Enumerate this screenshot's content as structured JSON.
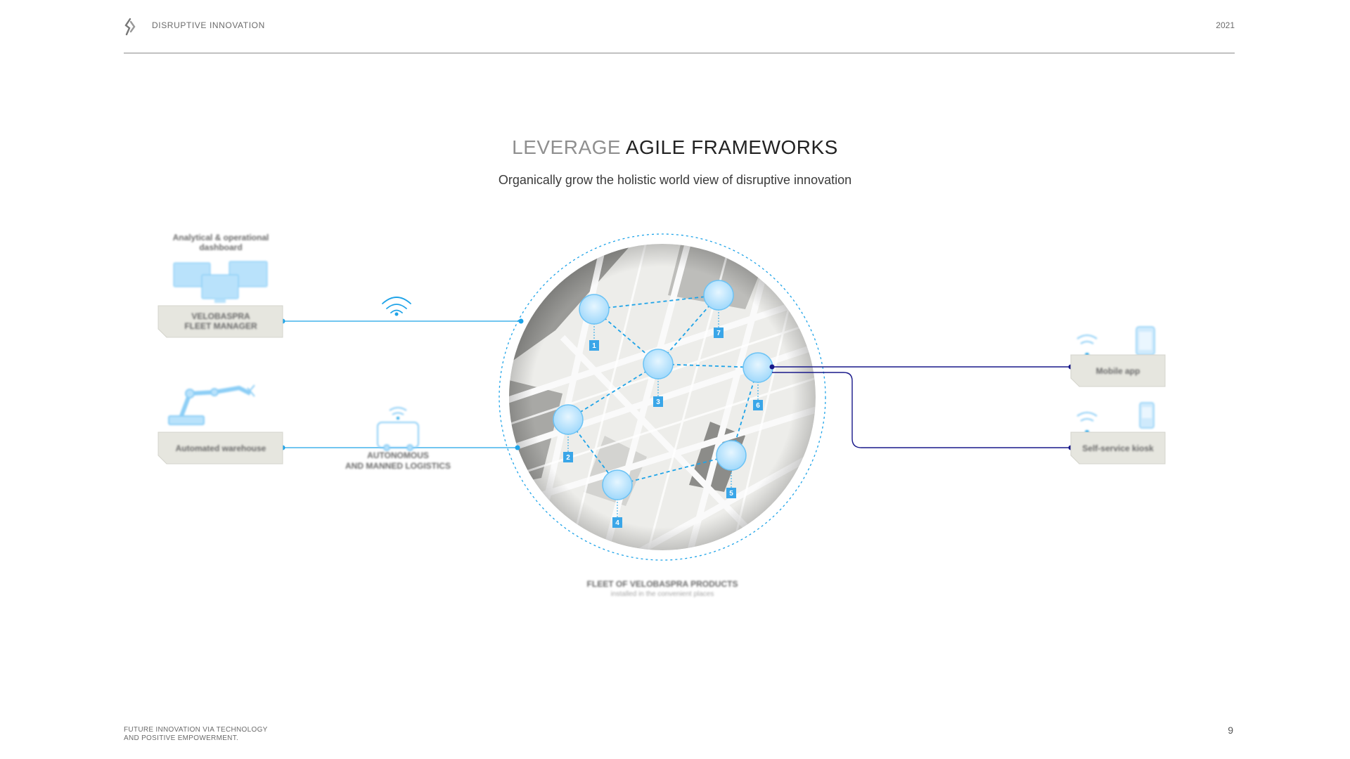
{
  "header": {
    "brand": "DISRUPTIVE INNOVATION",
    "year": "2021"
  },
  "title": {
    "light": "LEVERAGE",
    "dark": "AGILE FRAMEWORKS"
  },
  "subtitle": "Organically grow the holistic world view of disruptive innovation",
  "diagram": {
    "left": {
      "dashboard_caption": [
        "Analytical & operational",
        "dashboard"
      ],
      "fleet_manager_label": [
        "VELOBASPRA",
        "FLEET MANAGER"
      ],
      "warehouse_label": "Automated warehouse",
      "autonomous_caption": [
        "AUTONOMOUS",
        "AND MANNED LOGISTICS"
      ]
    },
    "right": {
      "mobile_label": "Mobile app",
      "kiosk_label": "Self-service kiosk"
    },
    "map": {
      "node_numbers": [
        "1",
        "2",
        "3",
        "4",
        "5",
        "6",
        "7"
      ]
    },
    "fleet_caption": {
      "title": "FLEET OF VELOBASPRA PRODUCTS",
      "sub": "installed in the convenient places"
    },
    "colors": {
      "accent": "#1ea3e8",
      "navy": "#18188a",
      "label_bg": "#e6e6df"
    }
  },
  "footer": {
    "line1": "FUTURE INNOVATION VIA TECHNOLOGY",
    "line2": "AND POSITIVE EMPOWERMENT."
  },
  "page_number": "9"
}
